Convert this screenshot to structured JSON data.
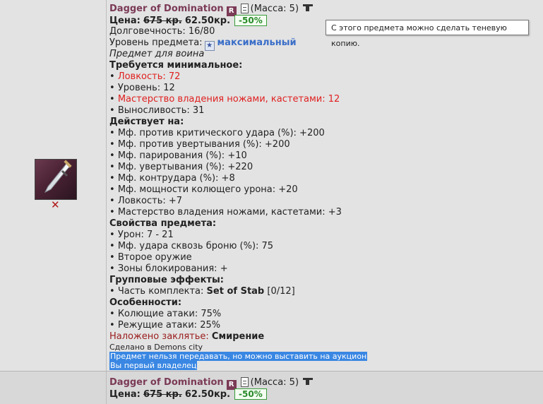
{
  "tooltip": "С этого предмета можно сделать теневую копию.",
  "item": {
    "name": "Dagger of Domination",
    "rarity_badge": "R",
    "mass": "(Масса: 5)",
    "price_label": "Цена:",
    "price_old": "675 кр.",
    "price_new": "62.50кр.",
    "discount": "-50%",
    "durability": "Долговечность: 16/80",
    "level_label": "Уровень предмета:",
    "level_value": "максимальный",
    "class_note": "Предмет для воина",
    "requirements_header": "Требуется минимальное:",
    "requirements": [
      {
        "text": "Ловкость: 72",
        "status": "unmet"
      },
      {
        "text": "Уровень: 12",
        "status": "met"
      },
      {
        "text": "Мастерство владения ножами, кастетами: 12",
        "status": "unmet"
      },
      {
        "text": "Выносливость: 31",
        "status": "met"
      }
    ],
    "effects_header": "Действует на:",
    "effects": [
      "Мф. против критического удара (%): +200",
      "Мф. против увертывания (%): +200",
      "Мф. парирования (%): +10",
      "Мф. увертывания (%): +220",
      "Мф. контрудара (%): +8",
      "Мф. мощности колющего урона: +20",
      "Ловкость: +7",
      "Мастерство владения ножами, кастетами: +3"
    ],
    "props_header": "Свойства предмета:",
    "props": [
      "Урон: 7 - 21",
      "Мф. удара сквозь броню (%): 75",
      "Второе оружие",
      "Зоны блокирования: +"
    ],
    "group_header": "Групповые эффекты:",
    "group_prefix": "Часть комплекта:",
    "group_set": "Set of Stab",
    "group_count": "[0/12]",
    "features_header": "Особенности:",
    "features": [
      "Колющие атаки: 75%",
      "Режущие атаки: 25%"
    ],
    "spell_label": "Наложено заклятье:",
    "spell_value": "Смирение",
    "made_in": "Сделано в Demons city",
    "note_transfer": "Предмет нельзя передавать, но можно выставить на аукцион",
    "note_owner": "Вы первый владелец"
  },
  "item2": {
    "name": "Dagger of Domination",
    "rarity_badge": "R",
    "mass": "(Масса: 5)",
    "price_label": "Цена:",
    "price_old": "675 кр.",
    "price_new": "62.50кр.",
    "discount": "-50%"
  },
  "colors": {
    "title": "#7b3a56",
    "unmet": "#e02020",
    "level": "#3a6ec8",
    "highlight": "#3a87e3",
    "discount": "#2a8a2a"
  },
  "icons": [
    "dagger-item-icon",
    "remove-cross-icon",
    "document-icon",
    "anvil-icon",
    "level-icon"
  ]
}
